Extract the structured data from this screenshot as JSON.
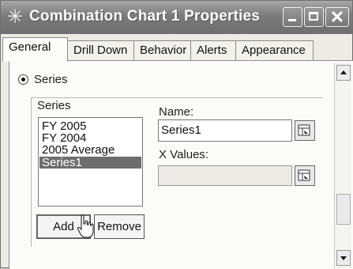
{
  "window": {
    "title": "Combination Chart 1 Properties",
    "icon": "asterisk-icon",
    "controls": {
      "close_glyph": "✕"
    }
  },
  "tabs": [
    {
      "label": "General",
      "active": true
    },
    {
      "label": "Drill Down",
      "active": false
    },
    {
      "label": "Behavior",
      "active": false
    },
    {
      "label": "Alerts",
      "active": false
    },
    {
      "label": "Appearance",
      "active": false
    }
  ],
  "general": {
    "series_option": {
      "label": "Series",
      "selected": true
    },
    "series_group": {
      "label": "Series",
      "items": [
        "FY 2005",
        "FY 2004",
        "2005 Average",
        "Series1"
      ],
      "selected_index": 3
    },
    "name": {
      "label": "Name:",
      "value": "Series1"
    },
    "x_values": {
      "label": "X Values:",
      "value": ""
    },
    "buttons": {
      "add": "Add",
      "remove": "Remove"
    }
  }
}
